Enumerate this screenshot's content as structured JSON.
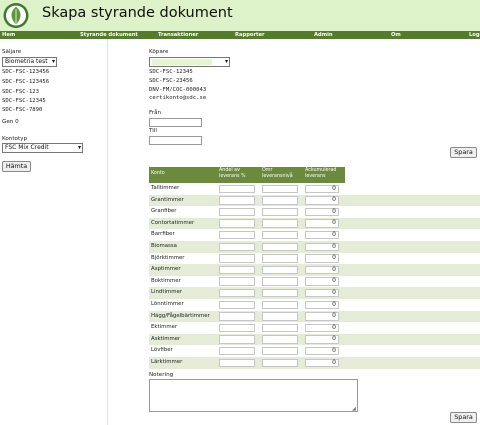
{
  "header": {
    "title": "Skapa styrande dokument",
    "logo_icon": "leaf-logo-icon"
  },
  "nav": [
    "Hem",
    "Styrande dokument",
    "Transaktioner",
    "Rapporter",
    "Admin",
    "Om",
    "Logout"
  ],
  "left": {
    "seller_label": "Säljare",
    "seller_selected": "Biometria test",
    "seller_codes": [
      "SDC-FSC-123456",
      "SDC-FSC-123456",
      "SDC-FSC-123",
      "SDC-FSC-12345",
      "SDC-FSC-7890"
    ],
    "gen_text": "Gen 0",
    "account_type_label": "Kontotyp",
    "account_type_selected": "FSC Mix Credit",
    "fetch_button": "Hämta"
  },
  "buyer": {
    "label": "Köpare",
    "selected": "",
    "codes": [
      "SDC-FSC-12345",
      "SDC-FSC-23456",
      "DNV-FM/COC-000043",
      "certikonto@sdc.se"
    ]
  },
  "dates": {
    "from_label": "Från",
    "to_label": "Till"
  },
  "save_button": "Spara",
  "table": {
    "headers": [
      "Konto",
      "Andel av leverans %",
      "Omr leveransnivå",
      "Ackumulerad leverans"
    ],
    "rows": [
      {
        "name": "Talltimmer",
        "acc": "0"
      },
      {
        "name": "Grantimmer",
        "acc": "0"
      },
      {
        "name": "Granfiber",
        "acc": "0"
      },
      {
        "name": "Contortatimmer",
        "acc": "0"
      },
      {
        "name": "Barrfiber",
        "acc": "0"
      },
      {
        "name": "Biomassa",
        "acc": "0"
      },
      {
        "name": "Björktimmer",
        "acc": "0"
      },
      {
        "name": "Asptimmer",
        "acc": "0"
      },
      {
        "name": "Boktimmer",
        "acc": "0"
      },
      {
        "name": "Lindtimmer",
        "acc": "0"
      },
      {
        "name": "Lönntimmer",
        "acc": "0"
      },
      {
        "name": "Hägg/Fågelbärtimmer",
        "acc": "0"
      },
      {
        "name": "Ektimmer",
        "acc": "0"
      },
      {
        "name": "Asktimmer",
        "acc": "0"
      },
      {
        "name": "Lövfiber",
        "acc": "0"
      },
      {
        "name": "Lärktimmer",
        "acc": "0"
      }
    ]
  },
  "note_label": "Notering",
  "colors": {
    "header_bg": "#ddf2c8",
    "nav_bg": "#567a2e",
    "table_head": "#6c8a3e",
    "row_alt": "#e4ecd8"
  }
}
